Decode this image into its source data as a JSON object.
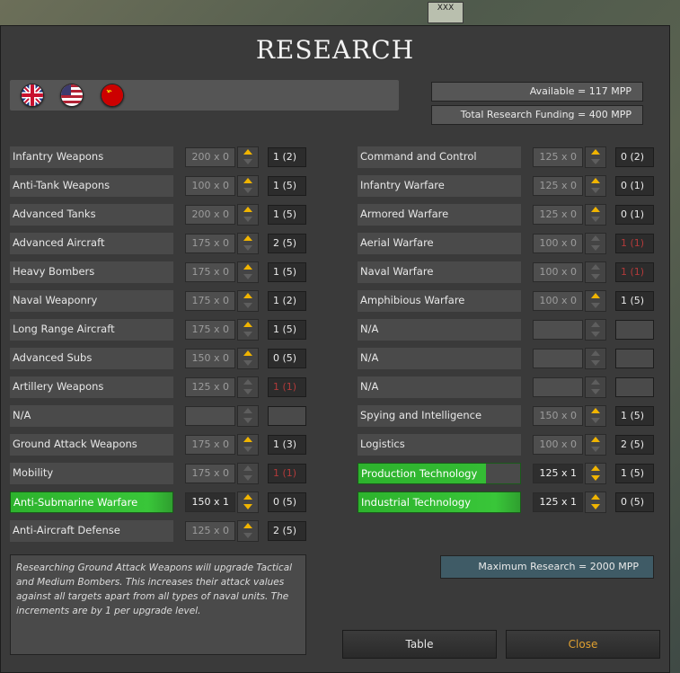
{
  "title": "RESEARCH",
  "map_unit_label": "XXX",
  "flags": [
    {
      "name": "uk-flag-icon"
    },
    {
      "name": "us-flag-icon"
    },
    {
      "name": "ussr-flag-icon"
    }
  ],
  "available": "Available = 117 MPP",
  "total_funding": "Total Research Funding = 400 MPP",
  "left_rows": [
    {
      "label": "Infantry Weapons",
      "cost": "200 x 0",
      "level": "1 (2)",
      "up": true,
      "down": false,
      "state": "normal"
    },
    {
      "label": "Anti-Tank Weapons",
      "cost": "100 x 0",
      "level": "1 (5)",
      "up": true,
      "down": false,
      "state": "normal"
    },
    {
      "label": "Advanced Tanks",
      "cost": "200 x 0",
      "level": "1 (5)",
      "up": true,
      "down": false,
      "state": "normal"
    },
    {
      "label": "Advanced Aircraft",
      "cost": "175 x 0",
      "level": "2 (5)",
      "up": true,
      "down": false,
      "state": "normal"
    },
    {
      "label": "Heavy Bombers",
      "cost": "175 x 0",
      "level": "1 (5)",
      "up": true,
      "down": false,
      "state": "normal"
    },
    {
      "label": "Naval Weaponry",
      "cost": "175 x 0",
      "level": "1 (2)",
      "up": true,
      "down": false,
      "state": "normal"
    },
    {
      "label": "Long Range Aircraft",
      "cost": "175 x 0",
      "level": "1 (5)",
      "up": true,
      "down": false,
      "state": "normal"
    },
    {
      "label": "Advanced Subs",
      "cost": "150 x 0",
      "level": "0 (5)",
      "up": true,
      "down": false,
      "state": "normal"
    },
    {
      "label": "Artillery Weapons",
      "cost": "125 x 0",
      "level": "1 (1)",
      "up": false,
      "down": false,
      "state": "maxed"
    },
    {
      "label": "N/A",
      "cost": "",
      "level": "",
      "up": false,
      "down": false,
      "state": "na"
    },
    {
      "label": "Ground Attack Weapons",
      "cost": "175 x 0",
      "level": "1 (3)",
      "up": true,
      "down": false,
      "state": "normal"
    },
    {
      "label": "Mobility",
      "cost": "175 x 0",
      "level": "1 (1)",
      "up": false,
      "down": false,
      "state": "maxed"
    },
    {
      "label": "Anti-Submarine Warfare",
      "cost": "150 x 1",
      "level": "0 (5)",
      "up": true,
      "down": true,
      "state": "active"
    },
    {
      "label": "Anti-Aircraft Defense",
      "cost": "125 x 0",
      "level": "2 (5)",
      "up": true,
      "down": false,
      "state": "normal"
    }
  ],
  "right_rows": [
    {
      "label": "Command and Control",
      "cost": "125 x 0",
      "level": "0 (2)",
      "up": true,
      "down": false,
      "state": "normal"
    },
    {
      "label": "Infantry Warfare",
      "cost": "125 x 0",
      "level": "0 (1)",
      "up": true,
      "down": false,
      "state": "normal"
    },
    {
      "label": "Armored Warfare",
      "cost": "125 x 0",
      "level": "0 (1)",
      "up": true,
      "down": false,
      "state": "normal"
    },
    {
      "label": "Aerial Warfare",
      "cost": "100 x 0",
      "level": "1 (1)",
      "up": false,
      "down": false,
      "state": "maxed"
    },
    {
      "label": "Naval Warfare",
      "cost": "100 x 0",
      "level": "1 (1)",
      "up": false,
      "down": false,
      "state": "maxed"
    },
    {
      "label": "Amphibious Warfare",
      "cost": "100 x 0",
      "level": "1 (5)",
      "up": true,
      "down": false,
      "state": "normal"
    },
    {
      "label": "N/A",
      "cost": "",
      "level": "",
      "up": false,
      "down": false,
      "state": "na"
    },
    {
      "label": "N/A",
      "cost": "",
      "level": "",
      "up": false,
      "down": false,
      "state": "na"
    },
    {
      "label": "N/A",
      "cost": "",
      "level": "",
      "up": false,
      "down": false,
      "state": "na"
    },
    {
      "label": "Spying and Intelligence",
      "cost": "150 x 0",
      "level": "1 (5)",
      "up": true,
      "down": false,
      "state": "normal"
    },
    {
      "label": "Logistics",
      "cost": "100 x 0",
      "level": "2 (5)",
      "up": true,
      "down": false,
      "state": "normal"
    },
    {
      "label": "Production Technology",
      "cost": "125 x 1",
      "level": "1 (5)",
      "up": true,
      "down": true,
      "state": "active",
      "progress": 0.79
    },
    {
      "label": "Industrial Technology",
      "cost": "125 x 1",
      "level": "0 (5)",
      "up": true,
      "down": true,
      "state": "active",
      "progress": 1.0
    }
  ],
  "description": "Researching Ground Attack Weapons will upgrade Tactical and Medium Bombers. This increases their attack values against all targets apart from all types of naval units. The increments are by 1 per upgrade level.",
  "max_research": "Maximum Research = 2000 MPP",
  "buttons": {
    "table": "Table",
    "close": "Close"
  },
  "colors": {
    "accent_arrow": "#f0b400",
    "active_green": "#39c639",
    "maxed_red": "#b23a3a",
    "close_text": "#e0a030"
  }
}
